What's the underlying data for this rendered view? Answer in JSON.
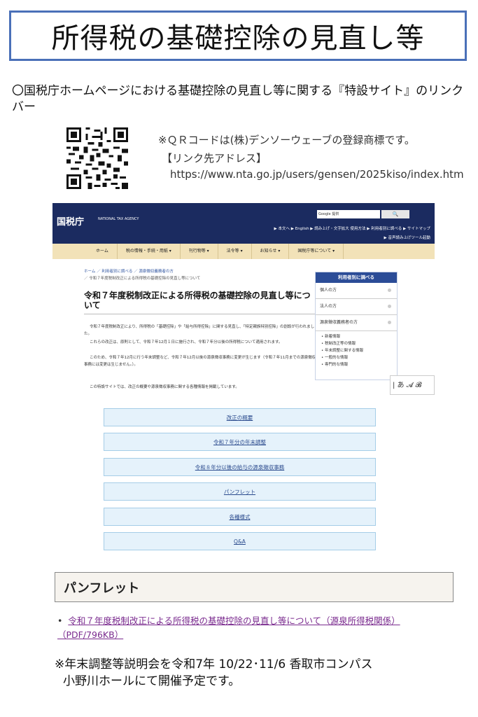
{
  "title": "所得税の基礎控除の見直し等",
  "intro": "〇国税庁ホームページにおける基礎控除の見直し等に関する『特設サイト』のリンクバー",
  "qr": {
    "note": "※ＱＲコードは(株)デンソーウェーブの登録商標です。",
    "link_label": "【リンク先アドレス】",
    "url": "https://www.nta.go.jp/users/gensen/2025kiso/index.htm"
  },
  "site": {
    "logo": "国税庁",
    "logo_sub": "NATIONAL TAX AGENCY",
    "search_placeholder": "Google 提供",
    "search_button": "🔍",
    "toplinks": "▶ 本文へ  ▶ English  ▶ 読み上げ・文字拡大  使用方法  ▶ 利用者別に調べる  ▶ サイトマップ",
    "toplinks2": "▶ 音声読み上げツール起動",
    "nav": [
      "ホーム",
      "税の情報・手続・用紙 ▾",
      "刊行物等 ▾",
      "法令等 ▾",
      "お知らせ ▾",
      "国税庁等について ▾"
    ],
    "breadcrumb1": "ホーム ／ 利用者別に調べる ／ 源泉徴収義務者の方",
    "breadcrumb2": "／ 令和７年度税制改正による所得税の基礎控除の見直し等について",
    "heading": "令和７年度税制改正による所得税の基礎控除の見直し等について",
    "para1": "令和７年度税制改正により、所得税の「基礎控除」や「給与所得控除」に関する見直し、「特定親族特別控除」の創設が行われました。",
    "para2": "これらの改正は、原則として、令和７年12月１日に施行され、令和７年分以後の所得税について適用されます。",
    "para3": "このため、令和７年12月に行う年末調整など、令和７年12月以後の源泉徴収事務に変更が生じます（令和７年11月までの源泉徴収事務には変更は生じません。）。",
    "para4": "この特設サイトでは、改正の概要や源泉徴収事務に関する各種情報を掲載しています。",
    "sidebar": {
      "head": "利用者別に調べる",
      "rows": [
        "個人の方",
        "法人の方",
        "源泉徴収義務者の方"
      ],
      "list": [
        "新着情報",
        "税制改正等の情報",
        "年末調整に関する情報",
        "一般的な情報",
        "専門的な情報"
      ]
    },
    "ime": "| あ 𝓐 𝓑"
  },
  "link_buttons": [
    "改正の概要",
    "令和７年分の年末調整",
    "令和８年分以後の給与の源泉徴収事務",
    "パンフレット",
    "各種様式",
    "Q&A"
  ],
  "pamphlet": {
    "heading": "パンフレット",
    "link": "令和７年度税制改正による所得税の基礎控除の見直し等について（源泉所得税関係）（PDF/796KB）"
  },
  "notice": {
    "line1": "※年末調整等説明会を令和7年 10/22･11/6 香取市コンパス",
    "line2": "小野川ホールにて開催予定です。"
  }
}
